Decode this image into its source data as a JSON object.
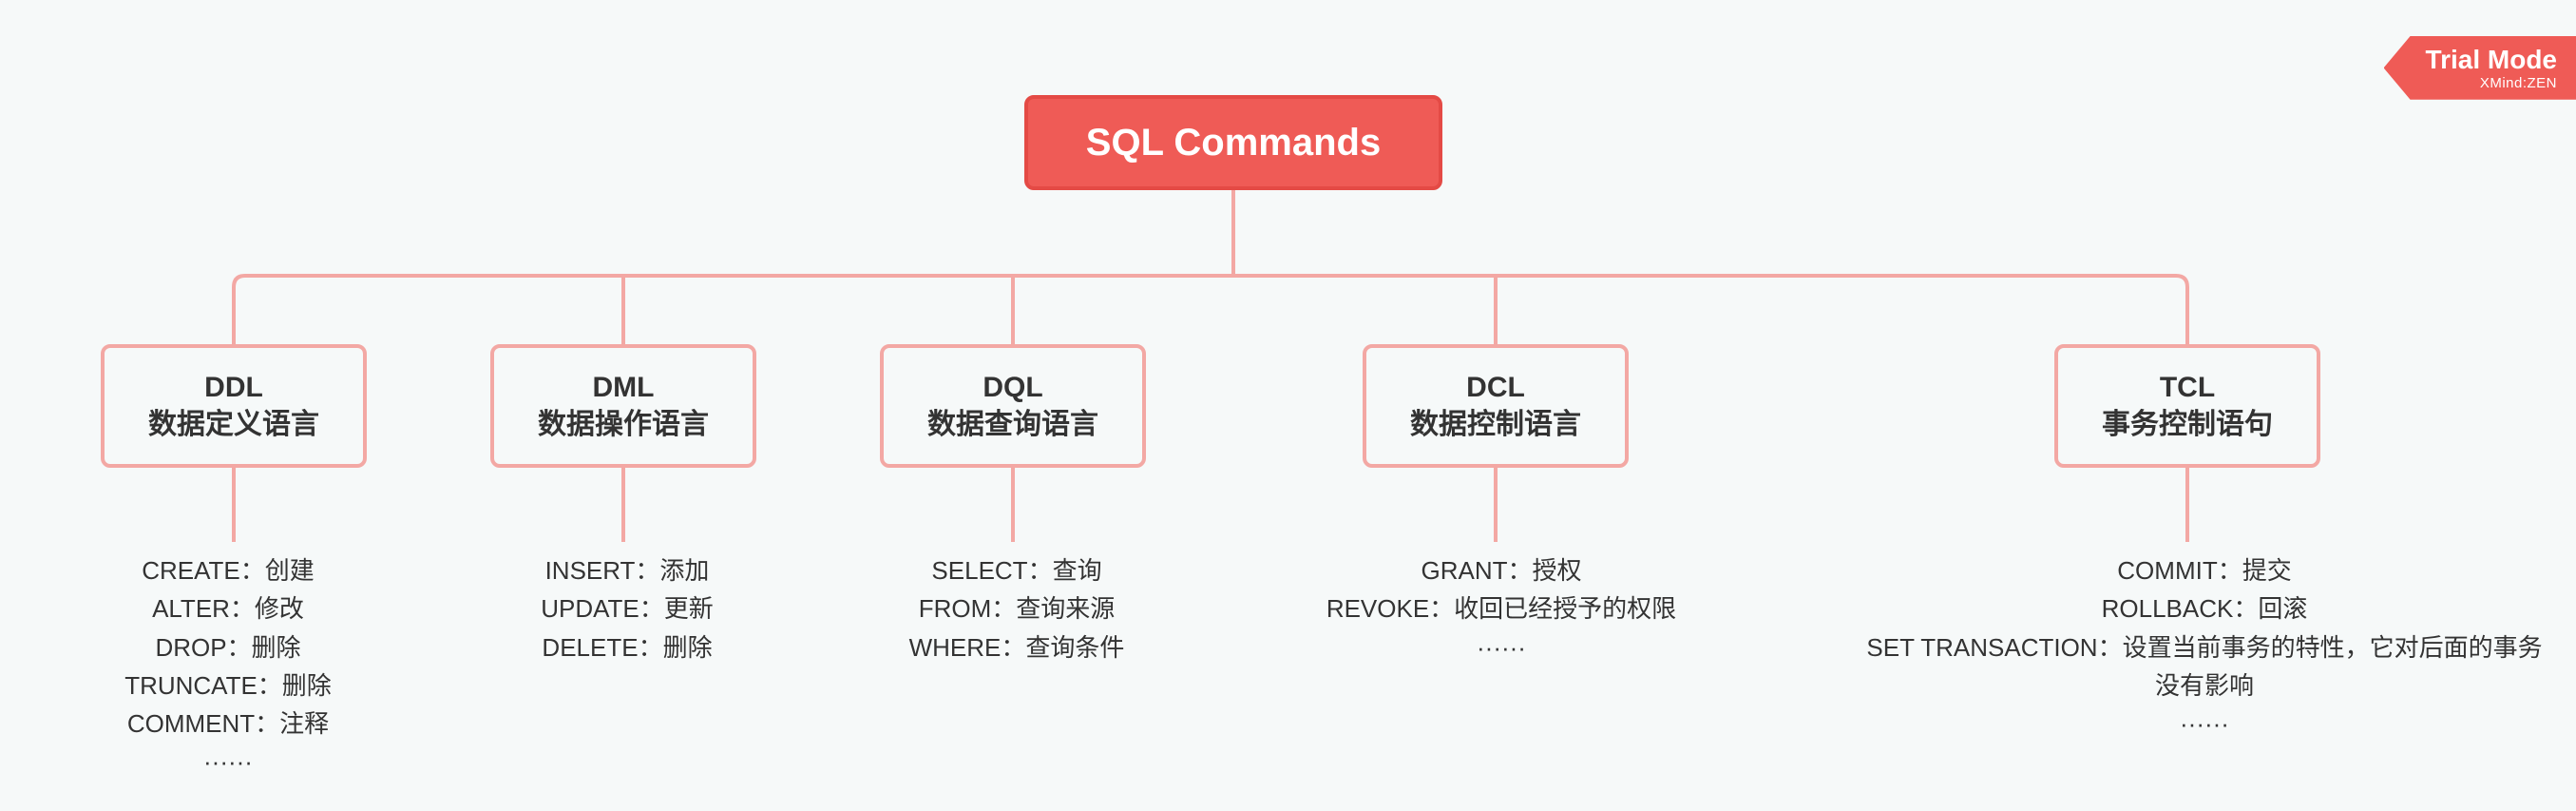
{
  "badge": {
    "title": "Trial Mode",
    "product_prefix": "XMind:",
    "product_suffix": "ZEN"
  },
  "root": {
    "title": "SQL Commands"
  },
  "categories": [
    {
      "abbr": "DDL",
      "name": "数据定义语言",
      "items": [
        "CREATE：创建",
        "ALTER：修改",
        "DROP：删除",
        "TRUNCATE：删除",
        "COMMENT：注释",
        "······"
      ]
    },
    {
      "abbr": "DML",
      "name": "数据操作语言",
      "items": [
        "INSERT：添加",
        "UPDATE：更新",
        "DELETE：删除"
      ]
    },
    {
      "abbr": "DQL",
      "name": "数据查询语言",
      "items": [
        "SELECT：查询",
        "FROM：查询来源",
        "WHERE：查询条件"
      ]
    },
    {
      "abbr": "DCL",
      "name": "数据控制语言",
      "items": [
        "GRANT：授权",
        "REVOKE：收回已经授予的权限",
        "······"
      ]
    },
    {
      "abbr": "TCL",
      "name": "事务控制语句",
      "items": [
        "COMMIT：提交",
        "ROLLBACK：回滚",
        "SET TRANSACTION：设置当前事务的特性，它对后面的事务没有影响",
        "······"
      ]
    }
  ],
  "colors": {
    "accent": "#ef5b56",
    "accent_border": "#e44a45",
    "connector": "#f3a8a4",
    "background": "#f6f9f9"
  }
}
